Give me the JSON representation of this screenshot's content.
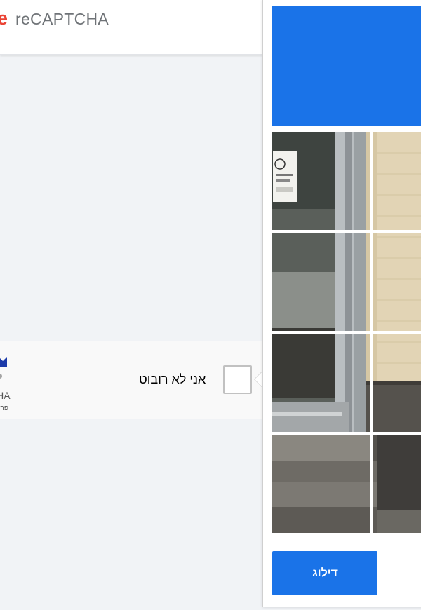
{
  "header": {
    "logo_letter": "e",
    "brand": "reCAPTCHA"
  },
  "widget": {
    "checkbox_label": "אני לא רובוט",
    "brand_partial": "CHA",
    "sub_partial": "פרט"
  },
  "challenge": {
    "header_color": "#1a73e8",
    "tiles": [
      {
        "id": 1
      },
      {
        "id": 2
      },
      {
        "id": 3
      },
      {
        "id": 4
      },
      {
        "id": 5
      },
      {
        "id": 6
      },
      {
        "id": 7
      },
      {
        "id": 8
      }
    ],
    "skip_label": "דילוג"
  },
  "colors": {
    "accent": "#1a73e8",
    "google_red": "#ea4335"
  }
}
